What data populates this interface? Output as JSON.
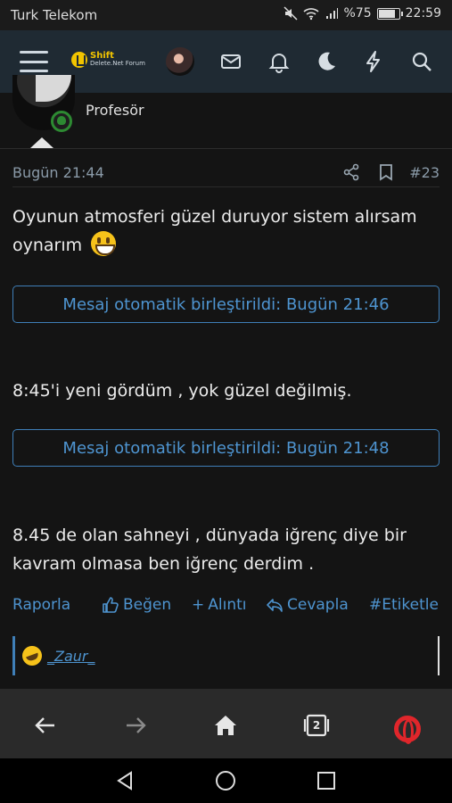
{
  "status_bar": {
    "carrier": "Turk Telekom",
    "battery_percent": "%75",
    "time": "22:59"
  },
  "header": {
    "logo_line1": "Shift",
    "logo_line2": "Delete.Net Forum",
    "icons": [
      "menu-icon",
      "envelope-icon",
      "bell-icon",
      "moon-icon",
      "bolt-icon",
      "search-icon"
    ]
  },
  "profile": {
    "role": "Profesör"
  },
  "post": {
    "time": "Bugün 21:44",
    "number": "#23",
    "paragraphs": [
      "Oyunun atmosferi güzel duruyor sistem alırsam oynarım",
      "8:45'i yeni gördüm , yok güzel değilmiş.",
      "8.45 de olan sahneyi , dünyada iğrenç diye bir kavram olmasa ben iğrenç derdim ."
    ],
    "merges": [
      "Mesaj otomatik birleştirildi: Bugün 21:46",
      "Mesaj otomatik birleştirildi: Bugün 21:48"
    ]
  },
  "actions": {
    "report": "Raporla",
    "like": "Beğen",
    "quote": "Alıntı",
    "reply": "Cevapla",
    "tag": "#Etiketle"
  },
  "reactions": {
    "user": "_Zaur_"
  },
  "browser": {
    "tab_count": "2"
  },
  "colors": {
    "accent": "#4e94d0",
    "header_bg": "#1f2a33",
    "online": "#2d8a32",
    "opera": "#e0262b"
  }
}
